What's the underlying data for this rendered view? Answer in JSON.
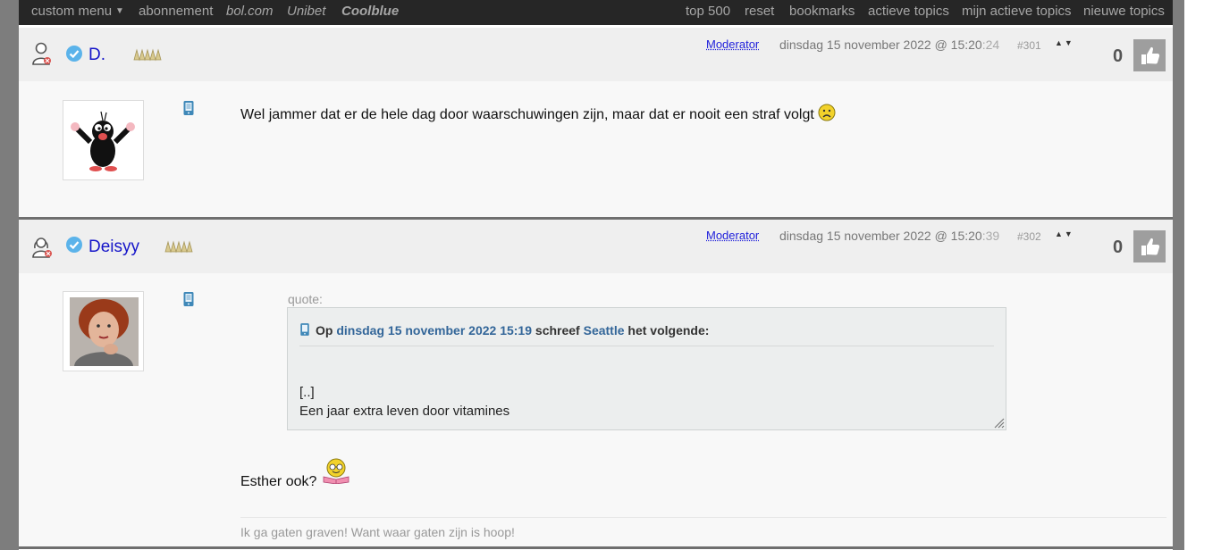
{
  "nav": {
    "left": [
      "custom menu",
      "abonnement",
      "bol.com",
      "Unibet",
      "Coolblue"
    ],
    "right": [
      "top 500",
      "reset",
      "bookmarks",
      "actieve topics",
      "mijn actieve topics",
      "nieuwe topics"
    ]
  },
  "posts": [
    {
      "username": "D.",
      "role": "Moderator",
      "date": "dinsdag 15 november 2022 @ 15:20",
      "seconds": ":24",
      "post_number": "#301",
      "score": "0",
      "message": "Wel jammer dat er de hele dag door waarschuwingen zijn, maar dat er nooit een straf volgt"
    },
    {
      "username": "Deisyy",
      "role": "Moderator",
      "date": "dinsdag 15 november 2022 @ 15:20",
      "seconds": ":39",
      "post_number": "#302",
      "score": "0",
      "quote": {
        "label": "quote:",
        "prefix": "Op",
        "date": "dinsdag 15 november 2022 15:19",
        "middle": "schreef",
        "author": "Seattle",
        "suffix": "het volgende:",
        "line1": "[..]",
        "line2": "Een jaar extra leven door vitamines"
      },
      "message": "Esther ook?",
      "signature": "Ik ga gaten graven! Want waar gaten zijn is hoop!"
    }
  ],
  "colors": {
    "username": "#1515c9",
    "link": "#336699",
    "topbar": "#262626"
  }
}
